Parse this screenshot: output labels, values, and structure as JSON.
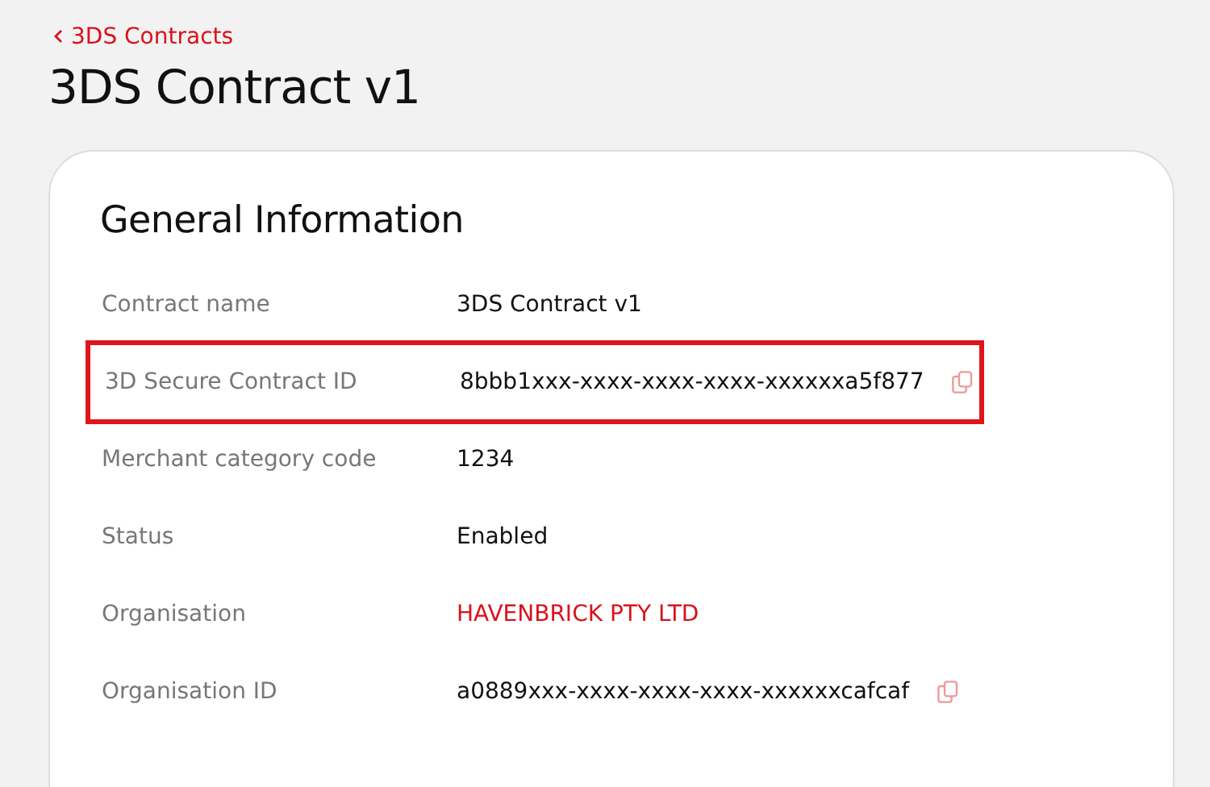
{
  "back_link": {
    "label": "3DS Contracts"
  },
  "title": "3DS Contract v1",
  "card": {
    "heading": "General Information",
    "rows": [
      {
        "label": "Contract name",
        "value": "3DS Contract v1",
        "kind": "text",
        "copyable": false,
        "highlighted": false
      },
      {
        "label": "3D Secure Contract ID",
        "value": "8bbb1xxx-xxxx-xxxx-xxxx-xxxxxxa5f877",
        "kind": "text",
        "copyable": true,
        "highlighted": true
      },
      {
        "label": "Merchant category code",
        "value": "1234",
        "kind": "text",
        "copyable": false,
        "highlighted": false
      },
      {
        "label": "Status",
        "value": "Enabled",
        "kind": "text",
        "copyable": false,
        "highlighted": false
      },
      {
        "label": "Organisation",
        "value": "HAVENBRICK PTY LTD",
        "kind": "link",
        "copyable": false,
        "highlighted": false
      },
      {
        "label": "Organisation ID",
        "value": "a0889xxx-xxxx-xxxx-xxxx-xxxxxxcafcaf",
        "kind": "text",
        "copyable": true,
        "highlighted": false
      }
    ]
  }
}
